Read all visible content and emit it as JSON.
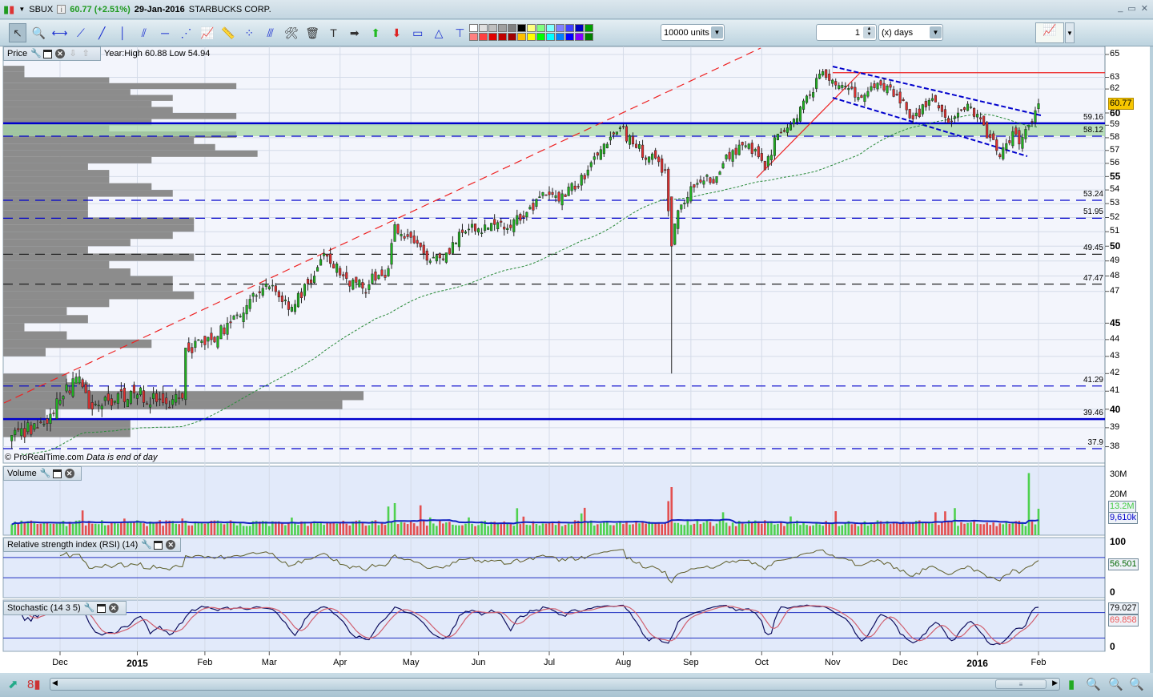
{
  "titlebar": {
    "symbol": "SBUX",
    "last": "60.77 (+2.51%)",
    "date": "29-Jan-2016",
    "name": "STARBUCKS CORP.",
    "info": "i",
    "win_buttons": [
      "_",
      "▭",
      "✕"
    ]
  },
  "toolbar": {
    "units": "10000 units",
    "period_value": "1",
    "period_unit": "(x) days",
    "tools": [
      "pointer",
      "zoom",
      "horizontal-line",
      "segment",
      "line",
      "vertical-line",
      "channel",
      "horizontal-ray",
      "fan",
      "trend-tool",
      "ruler",
      "points",
      "parallel",
      "settings",
      "delete",
      "text",
      "arrow-right",
      "arrow-up",
      "arrow-down",
      "rectangle",
      "triangle",
      "fib"
    ],
    "palette": [
      "#ffffff",
      "#e0e0e0",
      "#c0c0c0",
      "#a0a0a0",
      "#808080",
      "#000000",
      "#ffff80",
      "#80ff80",
      "#80ffff",
      "#8080ff",
      "#4040ff",
      "#0000c0",
      "#00a000",
      "#ff8080",
      "#ff4040",
      "#e00000",
      "#c00000",
      "#a00000",
      "#ffc000",
      "#ffff00",
      "#00ff00",
      "#00ffff",
      "#0080ff",
      "#0000ff",
      "#8000ff",
      "#008000"
    ]
  },
  "price_panel": {
    "label": "Price",
    "year_info": "Year:High 60.88 Low 54.94",
    "source": "© ProRealTime.com",
    "source_note": "Data is end of day",
    "last_value": "60.77"
  },
  "volume_panel": {
    "label": "Volume",
    "value": "13.2M",
    "ma_value": "9,610k",
    "ticks": [
      "30M",
      "20M"
    ]
  },
  "rsi_panel": {
    "label": "Relative strength index (RSI) (14)",
    "value": "56.501",
    "ticks": [
      "100",
      "0"
    ]
  },
  "stoch_panel": {
    "label": "Stochastic (14 3 5)",
    "k_value": "79.027",
    "d_value": "69.858",
    "ticks": [
      "0"
    ]
  },
  "chart_data": {
    "type": "candlestick",
    "symbol": "SBUX",
    "scale": "log",
    "y_ticks": [
      65,
      63,
      62,
      60,
      59,
      58,
      57,
      56,
      55,
      54,
      53,
      52,
      51,
      50,
      49,
      48,
      47,
      45,
      44,
      43,
      42,
      41,
      40,
      39,
      38
    ],
    "bold_ticks": [
      60,
      55,
      50,
      45,
      40
    ],
    "x_labels": [
      {
        "t": "Dec",
        "d": "2014-12-01"
      },
      {
        "t": "2015",
        "d": "2015-01-02",
        "bold": true
      },
      {
        "t": "Feb",
        "d": "2015-02-02"
      },
      {
        "t": "Mar",
        "d": "2015-03-02"
      },
      {
        "t": "Apr",
        "d": "2015-04-01"
      },
      {
        "t": "May",
        "d": "2015-05-01"
      },
      {
        "t": "Jun",
        "d": "2015-06-01"
      },
      {
        "t": "Jul",
        "d": "2015-07-01"
      },
      {
        "t": "Aug",
        "d": "2015-08-03"
      },
      {
        "t": "Sep",
        "d": "2015-09-01"
      },
      {
        "t": "Oct",
        "d": "2015-10-01"
      },
      {
        "t": "Nov",
        "d": "2015-11-02"
      },
      {
        "t": "Dec",
        "d": "2015-12-01"
      },
      {
        "t": "2016",
        "d": "2016-01-04",
        "bold": true
      },
      {
        "t": "Feb",
        "d": "2016-02-01"
      }
    ],
    "close_anchors": [
      [
        "2014-11-10",
        38.6
      ],
      [
        "2014-11-24",
        39.2
      ],
      [
        "2014-12-01",
        40.5
      ],
      [
        "2014-12-08",
        41.8
      ],
      [
        "2014-12-15",
        40.0
      ],
      [
        "2014-12-31",
        41.0
      ],
      [
        "2015-01-15",
        40.3
      ],
      [
        "2015-01-22",
        40.6
      ],
      [
        "2015-01-23",
        43.5
      ],
      [
        "2015-02-06",
        44.2
      ],
      [
        "2015-02-20",
        46.5
      ],
      [
        "2015-03-02",
        47.3
      ],
      [
        "2015-03-11",
        46.0
      ],
      [
        "2015-03-20",
        48.0
      ],
      [
        "2015-03-25",
        49.5
      ],
      [
        "2015-04-02",
        48.0
      ],
      [
        "2015-04-10",
        47.2
      ],
      [
        "2015-04-22",
        48.5
      ],
      [
        "2015-04-24",
        51.5
      ],
      [
        "2015-05-07",
        49.5
      ],
      [
        "2015-05-14",
        49.2
      ],
      [
        "2015-05-26",
        51.0
      ],
      [
        "2015-06-08",
        51.5
      ],
      [
        "2015-06-18",
        51.8
      ],
      [
        "2015-06-26",
        53.5
      ],
      [
        "2015-07-08",
        53.5
      ],
      [
        "2015-07-17",
        55.5
      ],
      [
        "2015-07-24",
        57.5
      ],
      [
        "2015-07-31",
        58.8
      ],
      [
        "2015-08-06",
        57.5
      ],
      [
        "2015-08-13",
        56.5
      ],
      [
        "2015-08-20",
        55.5
      ],
      [
        "2015-08-24",
        50.0
      ],
      [
        "2015-08-26",
        52.5
      ],
      [
        "2015-09-03",
        54.5
      ],
      [
        "2015-09-11",
        55.0
      ],
      [
        "2015-09-18",
        57.0
      ],
      [
        "2015-09-25",
        57.5
      ],
      [
        "2015-10-02",
        55.5
      ],
      [
        "2015-10-08",
        58.3
      ],
      [
        "2015-10-15",
        59.5
      ],
      [
        "2015-10-22",
        61.5
      ],
      [
        "2015-10-28",
        63.5
      ],
      [
        "2015-11-04",
        62.3
      ],
      [
        "2015-11-12",
        61.3
      ],
      [
        "2015-11-20",
        62.5
      ],
      [
        "2015-11-30",
        61.5
      ],
      [
        "2015-12-07",
        59.5
      ],
      [
        "2015-12-15",
        61.2
      ],
      [
        "2015-12-22",
        59.2
      ],
      [
        "2015-12-31",
        60.5
      ],
      [
        "2016-01-08",
        58.0
      ],
      [
        "2016-01-13",
        56.5
      ],
      [
        "2016-01-19",
        58.5
      ],
      [
        "2016-01-21",
        57.5
      ],
      [
        "2016-01-27",
        59.3
      ],
      [
        "2016-01-29",
        60.77
      ]
    ],
    "levels": [
      {
        "value": 59.16,
        "label": "59.16",
        "style": "solid-blue"
      },
      {
        "value": 58.12,
        "label": "58.12",
        "style": "dashed-blue"
      },
      {
        "value": 53.24,
        "label": "53.24",
        "style": "dashed-blue"
      },
      {
        "value": 51.95,
        "label": "51.95",
        "style": "dashed-blue"
      },
      {
        "value": 49.45,
        "label": "49.45",
        "style": "dashed-black"
      },
      {
        "value": 47.47,
        "label": "47.47",
        "style": "dashed-black"
      },
      {
        "value": 41.29,
        "label": "41.29",
        "style": "dashed-blue"
      },
      {
        "value": 39.46,
        "label": "39.46",
        "style": "solid-blue"
      },
      {
        "value": 37.9,
        "label": "37.9",
        "style": "dashed-blue"
      }
    ],
    "resistance_red": 63.4,
    "rsi_levels": [
      70,
      30
    ],
    "stoch_levels": [
      80,
      20
    ]
  }
}
